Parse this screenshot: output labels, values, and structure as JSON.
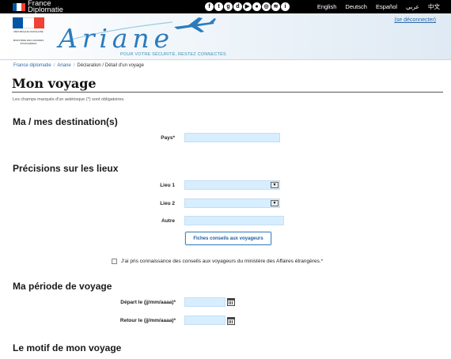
{
  "topbar": {
    "brand_line1": "France",
    "brand_line2": "Diplomatie",
    "social_icons": [
      "facebook-icon",
      "twitter-icon",
      "googleplus-icon",
      "dailymotion-icon",
      "youtube-icon",
      "flickr-icon",
      "instagram-icon",
      "rss-icon",
      "info-icon"
    ],
    "languages": [
      "English",
      "Deutsch",
      "Español",
      "عربي",
      "中文"
    ]
  },
  "header": {
    "logo_text": "Ariane",
    "tagline": "POUR VOTRE SÉCURITÉ, RESTEZ CONNECTÉS",
    "republic_text": "RÉPUBLIQUE FRANÇAISE",
    "ministry_text": "MINISTÈRE DES AFFAIRES ÉTRANGÈRES",
    "logout_label": "(se déconnecter)",
    "colors": {
      "blue": "#0055a4",
      "red": "#ef4135",
      "accent": "#2b7bbd"
    }
  },
  "breadcrumb": {
    "items": [
      "France diplomatie",
      "Ariane",
      "Déclaration / Détail d'un voyage"
    ]
  },
  "page": {
    "title": "Mon voyage",
    "mandatory_note": "Les champs marqués d'un astérisque (*) sont obligatoires."
  },
  "sections": {
    "destinations": {
      "title": "Ma / mes destination(s)",
      "pays_label": "Pays*",
      "pays_value": ""
    },
    "lieux": {
      "title": "Précisions sur les lieux",
      "lieu1_label": "Lieu 1",
      "lieu1_value": "",
      "lieu2_label": "Lieu 2",
      "lieu2_value": "",
      "autre_label": "Autre",
      "autre_value": "",
      "advice_button": "Fiches conseils aux voyageurs",
      "ack_label": "J'ai pris connaissance des conseils aux voyageurs du ministère des Affaires étrangères.*",
      "ack_checked": false
    },
    "periode": {
      "title": "Ma période de voyage",
      "depart_label": "Départ le (jj/mm/aaaa)*",
      "depart_value": "",
      "retour_label": "Retour le (jj/mm/aaaa)*",
      "retour_value": ""
    },
    "motif": {
      "title": "Le motif de mon voyage"
    }
  }
}
